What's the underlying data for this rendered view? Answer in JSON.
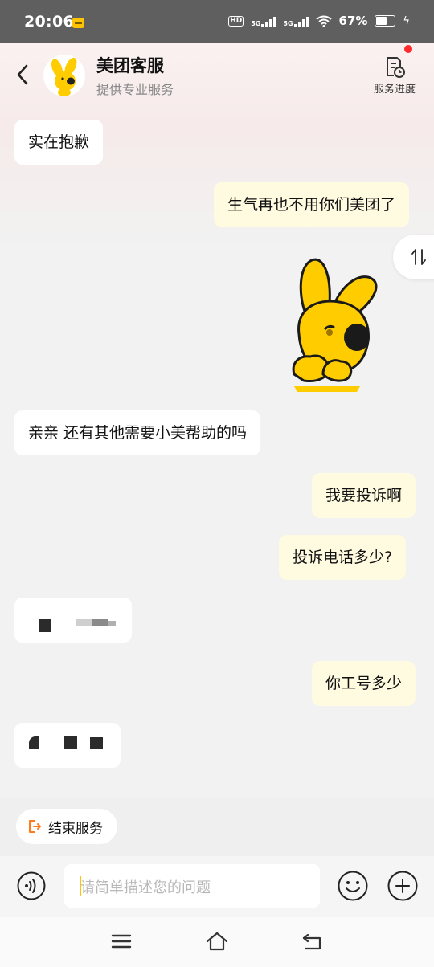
{
  "status_bar": {
    "time": "20:06",
    "network_badge": "HD",
    "network_label_1": "5G",
    "network_label_2": "5G",
    "battery_percent": "67%",
    "battery_level": 0.67
  },
  "header": {
    "title": "美团客服",
    "subtitle": "提供专业服务",
    "progress_label": "服务进度",
    "has_notification_dot": true
  },
  "messages": [
    {
      "side": "agent",
      "text": "实在抱歉"
    },
    {
      "side": "user",
      "text": "生气再也不用你们美团了"
    },
    {
      "side": "user",
      "type": "sticker",
      "icon": "yellow-dog-sticker"
    },
    {
      "side": "agent",
      "text": "亲亲 还有其他需要小美帮助的吗"
    },
    {
      "side": "user",
      "text": "我要投诉啊"
    },
    {
      "side": "user",
      "text": "投诉电话多少?"
    },
    {
      "side": "agent",
      "redacted": true
    },
    {
      "side": "user",
      "text": "你工号多少"
    },
    {
      "side": "agent",
      "redacted": true
    }
  ],
  "end_service": {
    "label": "结束服务"
  },
  "composer": {
    "placeholder": "请简单描述您的问题"
  },
  "colors": {
    "accent_yellow": "#ffc300",
    "user_bubble": "#fffbe0",
    "agent_bubble": "#ffffff",
    "notification_dot": "#ff2b2b",
    "end_icon": "#ff7a1a"
  },
  "icons": {
    "back": "back-chevron-icon",
    "progress": "document-clock-icon",
    "sort": "swap-vertical-icon",
    "voice": "voice-icon",
    "emoji": "smiley-icon",
    "plus": "plus-icon",
    "end": "exit-icon"
  }
}
